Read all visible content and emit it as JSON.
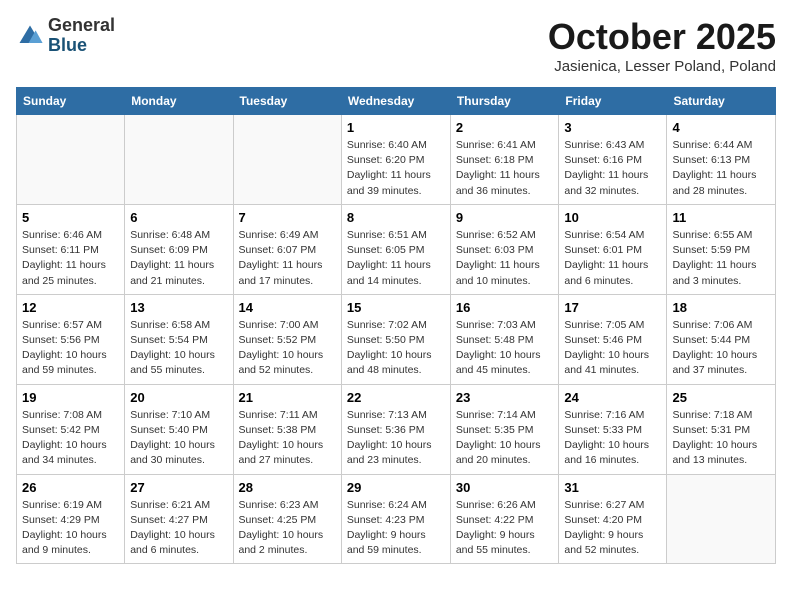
{
  "header": {
    "logo_general": "General",
    "logo_blue": "Blue",
    "month": "October 2025",
    "location": "Jasienica, Lesser Poland, Poland"
  },
  "weekdays": [
    "Sunday",
    "Monday",
    "Tuesday",
    "Wednesday",
    "Thursday",
    "Friday",
    "Saturday"
  ],
  "weeks": [
    [
      {
        "day": "",
        "info": ""
      },
      {
        "day": "",
        "info": ""
      },
      {
        "day": "",
        "info": ""
      },
      {
        "day": "1",
        "info": "Sunrise: 6:40 AM\nSunset: 6:20 PM\nDaylight: 11 hours\nand 39 minutes."
      },
      {
        "day": "2",
        "info": "Sunrise: 6:41 AM\nSunset: 6:18 PM\nDaylight: 11 hours\nand 36 minutes."
      },
      {
        "day": "3",
        "info": "Sunrise: 6:43 AM\nSunset: 6:16 PM\nDaylight: 11 hours\nand 32 minutes."
      },
      {
        "day": "4",
        "info": "Sunrise: 6:44 AM\nSunset: 6:13 PM\nDaylight: 11 hours\nand 28 minutes."
      }
    ],
    [
      {
        "day": "5",
        "info": "Sunrise: 6:46 AM\nSunset: 6:11 PM\nDaylight: 11 hours\nand 25 minutes."
      },
      {
        "day": "6",
        "info": "Sunrise: 6:48 AM\nSunset: 6:09 PM\nDaylight: 11 hours\nand 21 minutes."
      },
      {
        "day": "7",
        "info": "Sunrise: 6:49 AM\nSunset: 6:07 PM\nDaylight: 11 hours\nand 17 minutes."
      },
      {
        "day": "8",
        "info": "Sunrise: 6:51 AM\nSunset: 6:05 PM\nDaylight: 11 hours\nand 14 minutes."
      },
      {
        "day": "9",
        "info": "Sunrise: 6:52 AM\nSunset: 6:03 PM\nDaylight: 11 hours\nand 10 minutes."
      },
      {
        "day": "10",
        "info": "Sunrise: 6:54 AM\nSunset: 6:01 PM\nDaylight: 11 hours\nand 6 minutes."
      },
      {
        "day": "11",
        "info": "Sunrise: 6:55 AM\nSunset: 5:59 PM\nDaylight: 11 hours\nand 3 minutes."
      }
    ],
    [
      {
        "day": "12",
        "info": "Sunrise: 6:57 AM\nSunset: 5:56 PM\nDaylight: 10 hours\nand 59 minutes."
      },
      {
        "day": "13",
        "info": "Sunrise: 6:58 AM\nSunset: 5:54 PM\nDaylight: 10 hours\nand 55 minutes."
      },
      {
        "day": "14",
        "info": "Sunrise: 7:00 AM\nSunset: 5:52 PM\nDaylight: 10 hours\nand 52 minutes."
      },
      {
        "day": "15",
        "info": "Sunrise: 7:02 AM\nSunset: 5:50 PM\nDaylight: 10 hours\nand 48 minutes."
      },
      {
        "day": "16",
        "info": "Sunrise: 7:03 AM\nSunset: 5:48 PM\nDaylight: 10 hours\nand 45 minutes."
      },
      {
        "day": "17",
        "info": "Sunrise: 7:05 AM\nSunset: 5:46 PM\nDaylight: 10 hours\nand 41 minutes."
      },
      {
        "day": "18",
        "info": "Sunrise: 7:06 AM\nSunset: 5:44 PM\nDaylight: 10 hours\nand 37 minutes."
      }
    ],
    [
      {
        "day": "19",
        "info": "Sunrise: 7:08 AM\nSunset: 5:42 PM\nDaylight: 10 hours\nand 34 minutes."
      },
      {
        "day": "20",
        "info": "Sunrise: 7:10 AM\nSunset: 5:40 PM\nDaylight: 10 hours\nand 30 minutes."
      },
      {
        "day": "21",
        "info": "Sunrise: 7:11 AM\nSunset: 5:38 PM\nDaylight: 10 hours\nand 27 minutes."
      },
      {
        "day": "22",
        "info": "Sunrise: 7:13 AM\nSunset: 5:36 PM\nDaylight: 10 hours\nand 23 minutes."
      },
      {
        "day": "23",
        "info": "Sunrise: 7:14 AM\nSunset: 5:35 PM\nDaylight: 10 hours\nand 20 minutes."
      },
      {
        "day": "24",
        "info": "Sunrise: 7:16 AM\nSunset: 5:33 PM\nDaylight: 10 hours\nand 16 minutes."
      },
      {
        "day": "25",
        "info": "Sunrise: 7:18 AM\nSunset: 5:31 PM\nDaylight: 10 hours\nand 13 minutes."
      }
    ],
    [
      {
        "day": "26",
        "info": "Sunrise: 6:19 AM\nSunset: 4:29 PM\nDaylight: 10 hours\nand 9 minutes."
      },
      {
        "day": "27",
        "info": "Sunrise: 6:21 AM\nSunset: 4:27 PM\nDaylight: 10 hours\nand 6 minutes."
      },
      {
        "day": "28",
        "info": "Sunrise: 6:23 AM\nSunset: 4:25 PM\nDaylight: 10 hours\nand 2 minutes."
      },
      {
        "day": "29",
        "info": "Sunrise: 6:24 AM\nSunset: 4:23 PM\nDaylight: 9 hours\nand 59 minutes."
      },
      {
        "day": "30",
        "info": "Sunrise: 6:26 AM\nSunset: 4:22 PM\nDaylight: 9 hours\nand 55 minutes."
      },
      {
        "day": "31",
        "info": "Sunrise: 6:27 AM\nSunset: 4:20 PM\nDaylight: 9 hours\nand 52 minutes."
      },
      {
        "day": "",
        "info": ""
      }
    ]
  ]
}
